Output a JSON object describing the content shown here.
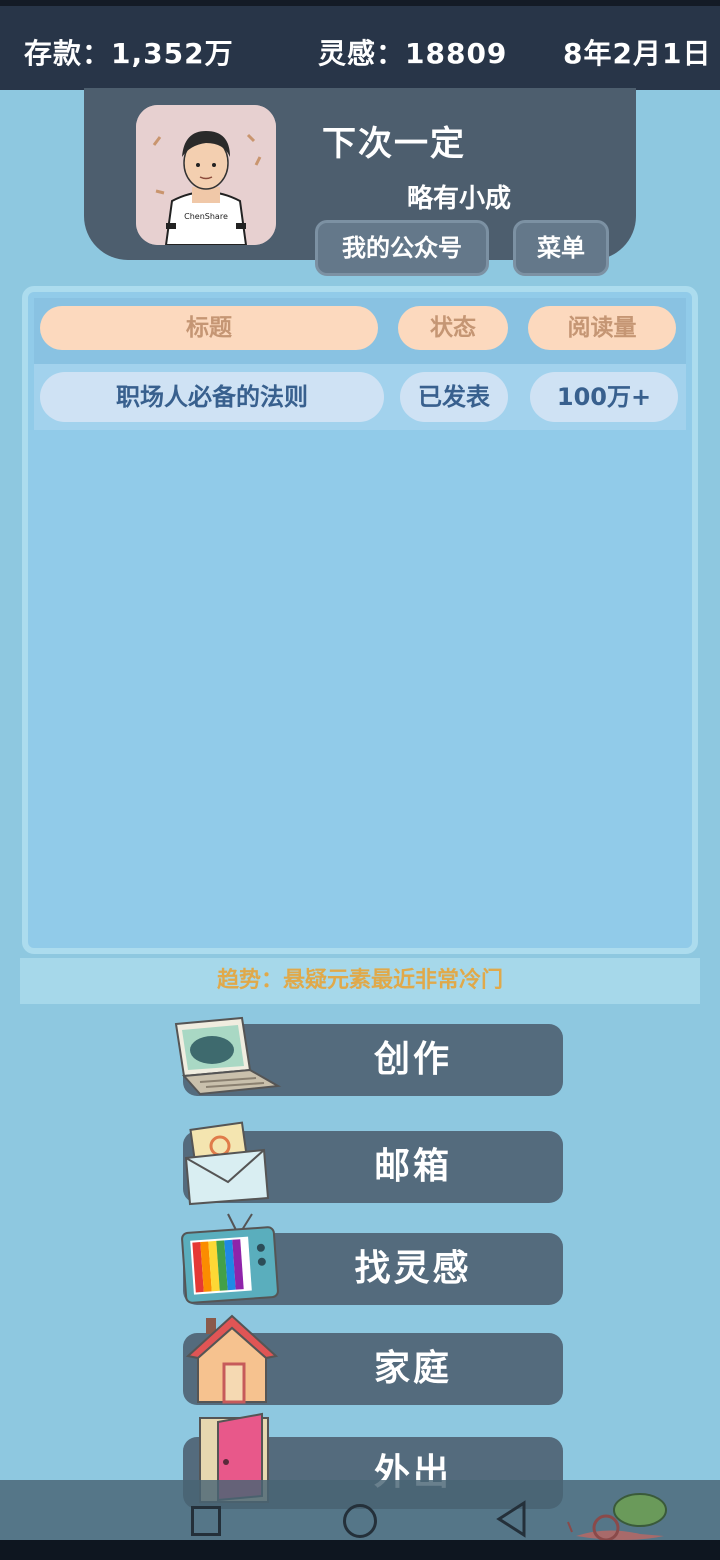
{
  "status_bar": {
    "savings": "存款：1,352万",
    "inspiration": "灵感：18809",
    "date": "8年2月1日"
  },
  "profile": {
    "name": "下次一定",
    "rank": "略有小成",
    "avatar_shirt_text": "ChenShare",
    "account_button": "我的公众号",
    "menu_button": "菜单"
  },
  "articles": {
    "headers": [
      "标题",
      "状态",
      "阅读量"
    ],
    "rows": [
      {
        "title": "职场人必备的法则",
        "status": "已发表",
        "reads": "100万+"
      }
    ]
  },
  "trend": "趋势：悬疑元素最近非常冷门",
  "actions": [
    {
      "label": "创作",
      "icon": "laptop-icon"
    },
    {
      "label": "邮箱",
      "icon": "mail-envelope-icon"
    },
    {
      "label": "找灵感",
      "icon": "tv-icon"
    },
    {
      "label": "家庭",
      "icon": "house-icon"
    },
    {
      "label": "外出",
      "icon": "door-icon"
    }
  ],
  "nav": {
    "recent": "square-icon",
    "home": "circle-icon",
    "back": "triangle-back-icon"
  },
  "colors": {
    "background": "#8ec8e0",
    "top_bar": "#283548",
    "profile_card": "#4d5e6e",
    "action_button": "#546b7d",
    "header_pill": "#fcd9be",
    "row_pill": "#cfe2f4",
    "trend_text": "#e0a94a"
  }
}
